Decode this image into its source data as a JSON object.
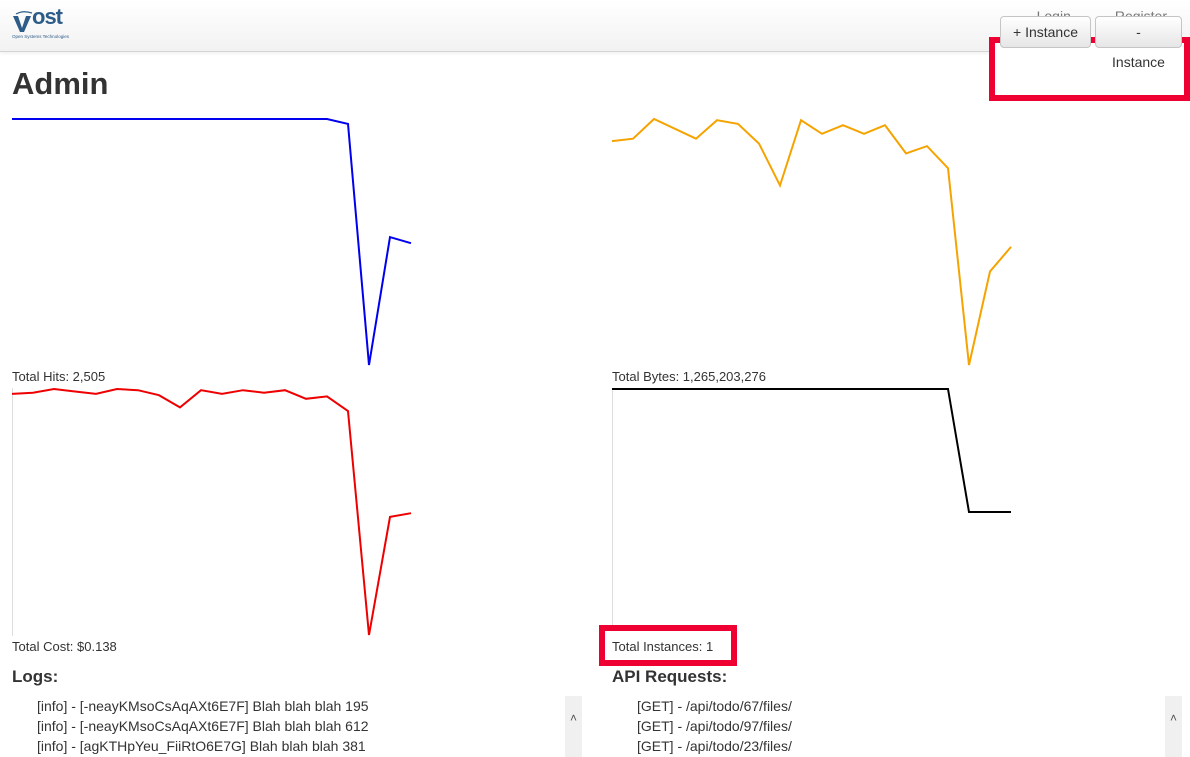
{
  "nav": {
    "logo_text": "ost",
    "logo_subtext": "Open Systems Technologies",
    "login": "Login",
    "register": "Register"
  },
  "page": {
    "title": "Admin"
  },
  "actions": {
    "add_instance": "+ Instance",
    "remove_instance": "- Instance"
  },
  "colors": {
    "hits": "#0000ee",
    "bytes": "#f5a300",
    "cost": "#ee0000",
    "instances": "#000000",
    "highlight": "#ee0033"
  },
  "stats": {
    "hits_label": "Total Hits: 2,505",
    "bytes_label": "Total Bytes: 1,265,203,276",
    "cost_label": "Total Cost: $0.138",
    "instances_label": "Total Instances: 1"
  },
  "chart_data": [
    {
      "type": "line",
      "name": "hits",
      "ylim": [
        0,
        100
      ],
      "values": [
        100,
        100,
        100,
        100,
        100,
        100,
        100,
        100,
        100,
        100,
        100,
        100,
        100,
        100,
        100,
        100,
        98,
        0,
        52,
        49.5
      ]
    },
    {
      "type": "line",
      "name": "bytes",
      "ylim": [
        0,
        100
      ],
      "values": [
        91,
        92,
        100,
        96,
        92,
        99.5,
        98,
        90,
        73,
        99.5,
        94,
        97.5,
        94,
        97.5,
        86,
        89,
        80,
        0,
        38,
        48
      ]
    },
    {
      "type": "line",
      "name": "cost",
      "ylim": [
        0,
        100
      ],
      "values": [
        98,
        98.5,
        100,
        99,
        98,
        100,
        99.5,
        97.5,
        92.5,
        99.5,
        98,
        99.5,
        98.5,
        99.5,
        96,
        97,
        91,
        0,
        48,
        49.5
      ]
    },
    {
      "type": "line",
      "name": "instances",
      "ylim": [
        0,
        2
      ],
      "values": [
        2,
        2,
        2,
        2,
        2,
        2,
        2,
        2,
        2,
        2,
        2,
        2,
        2,
        2,
        2,
        2,
        2,
        1,
        1,
        1
      ]
    }
  ],
  "logs": {
    "title": "Logs:",
    "items": [
      "[info] - [-neayKMsoCsAqAXt6E7F] Blah blah blah 195",
      "[info] - [-neayKMsoCsAqAXt6E7F] Blah blah blah 612",
      "[info] - [agKTHpYeu_FiiRtO6E7G] Blah blah blah 381"
    ]
  },
  "api": {
    "title": "API Requests:",
    "items": [
      "[GET] - /api/todo/67/files/",
      "[GET] - /api/todo/97/files/",
      "[GET] - /api/todo/23/files/"
    ]
  },
  "icons": {
    "scroll_up": "chevron-up-icon"
  }
}
